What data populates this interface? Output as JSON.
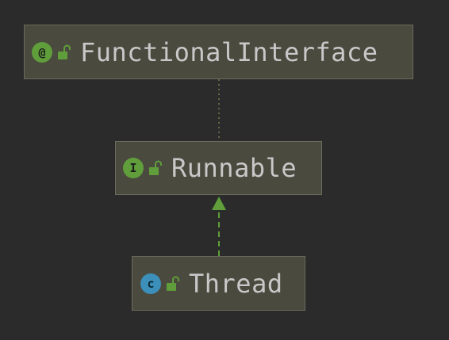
{
  "diagram": {
    "nodes": [
      {
        "id": "functional",
        "label": "FunctionalInterface",
        "kind_icon": "annotation-icon",
        "kind_glyph": "@"
      },
      {
        "id": "runnable",
        "label": "Runnable",
        "kind_icon": "interface-icon",
        "kind_glyph": "I"
      },
      {
        "id": "thread",
        "label": "Thread",
        "kind_icon": "class-icon",
        "kind_glyph": "c"
      }
    ],
    "edges": [
      {
        "from": "runnable",
        "to": "functional",
        "style": "dotted",
        "meaning": "annotated-with"
      },
      {
        "from": "thread",
        "to": "runnable",
        "style": "dashed-arrow",
        "meaning": "implements"
      }
    ],
    "colors": {
      "background": "#2b2b2b",
      "node_fill": "#4a4a3f",
      "node_border": "#6b6b5c",
      "label": "#c8c8c8",
      "annotation_badge": "#5f9e3a",
      "interface_badge": "#5f9e3a",
      "class_badge": "#3b8fb8",
      "lock": "#5f9e3a",
      "edge_dotted": "#7a7a55",
      "edge_implements": "#5f9e3a"
    }
  }
}
